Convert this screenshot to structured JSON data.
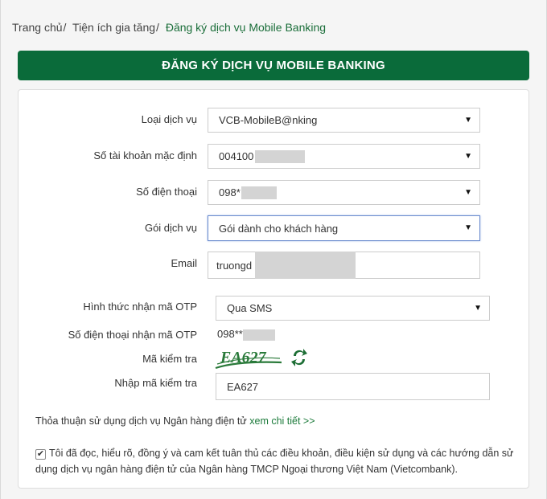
{
  "breadcrumb": {
    "home": "Trang chủ",
    "section": "Tiện ích gia tăng",
    "current": "Đăng ký dịch vụ Mobile Banking",
    "separator": "/"
  },
  "banner": {
    "title": "ĐĂNG KÝ DỊCH VỤ MOBILE BANKING"
  },
  "form": {
    "service_type": {
      "label": "Loại dịch vụ",
      "value": "VCB-MobileB@nking"
    },
    "default_account": {
      "label": "Số tài khoản mặc định",
      "value": "004100"
    },
    "phone": {
      "label": "Số điện thoại",
      "value": "098*"
    },
    "package": {
      "label": "Gói dịch vụ",
      "value": "Gói dành cho khách hàng"
    },
    "email": {
      "label": "Email",
      "value": "truongd"
    },
    "otp_method": {
      "label": "Hình thức nhận mã OTP",
      "value": "Qua SMS"
    },
    "otp_phone": {
      "label": "Số điện thoại nhận mã OTP",
      "value": "098**"
    },
    "captcha": {
      "label": "Mã kiểm tra",
      "image_text": "EA627"
    },
    "captcha_input": {
      "label": "Nhập mã kiểm tra",
      "value": "EA627"
    }
  },
  "agreement": {
    "text": "Thỏa thuận sử dụng dịch vụ Ngân hàng điện tử",
    "link": "xem chi tiết >>"
  },
  "terms": {
    "checked": true,
    "text": "Tôi đã đọc, hiểu rõ, đồng ý và cam kết tuân thủ các điều khoản, điều kiện sử dụng và các hướng dẫn sử dụng dịch vụ ngân hàng điện tử của Ngân hàng TMCP Ngoại thương Việt Nam (Vietcombank)."
  },
  "colors": {
    "brand_green": "#0a6b3a",
    "link_green": "#1b7a3a",
    "focus_border": "#6b8cce"
  },
  "icons": {
    "dropdown": "caret-down-icon",
    "refresh": "refresh-captcha-icon",
    "check": "check-icon"
  }
}
